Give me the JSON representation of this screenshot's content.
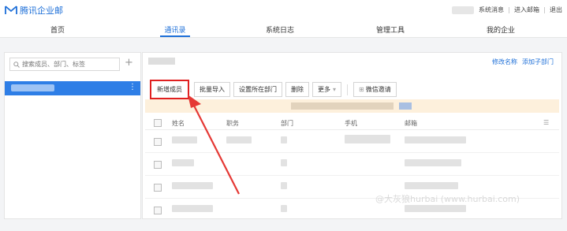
{
  "app": {
    "logo_text": "腾讯企业邮",
    "brand_color": "#1d6fd8"
  },
  "top_links": [
    "系统消息",
    "进入邮箱",
    "退出"
  ],
  "nav": {
    "tabs": [
      "首页",
      "通讯录",
      "系统日志",
      "管理工具",
      "我的企业"
    ],
    "active": "通讯录"
  },
  "search": {
    "placeholder": "搜索成员、部门、标签"
  },
  "sidebar": {
    "add_symbol": "+",
    "more_symbol": "⋮"
  },
  "main": {
    "right_links": [
      "修改名称",
      "添加子部门"
    ]
  },
  "toolbar": {
    "add_member": "新增成员",
    "batch_import": "批量导入",
    "set_dept": "设置所在部门",
    "delete": "删除",
    "more": "更多",
    "wechat_invite": "微信邀请"
  },
  "table": {
    "headers": [
      "姓名",
      "职务",
      "部门",
      "手机",
      "邮箱"
    ]
  },
  "watermark": "@大灰狼hurbai (www.hurbai.com)",
  "colors": {
    "accent": "#1d6fd8",
    "highlight": "#e02020",
    "banner": "#fdf0dc"
  }
}
